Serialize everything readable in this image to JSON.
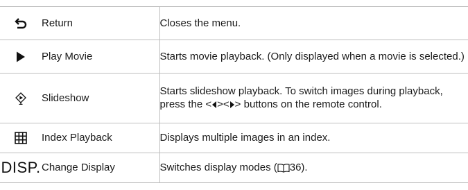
{
  "rows": [
    {
      "icon": "return-arrow-icon",
      "name": "Return",
      "description": "Closes the menu."
    },
    {
      "icon": "play-icon",
      "name": "Play Movie",
      "description": "Starts movie playback. (Only displayed when a movie is selected.)"
    },
    {
      "icon": "slideshow-icon",
      "name": "Slideshow",
      "description_parts": {
        "before": "Starts slideshow playback. To switch images during playback, press the <",
        "middle": "><",
        "after": "> buttons on the remote control."
      }
    },
    {
      "icon": "index-grid-icon",
      "name": "Index Playback",
      "description": "Displays multiple images in an index."
    },
    {
      "icon_text": "DISP.",
      "name": "Change Display",
      "description_before": "Switches display modes (",
      "page_ref": "36",
      "description_after": ")."
    }
  ]
}
